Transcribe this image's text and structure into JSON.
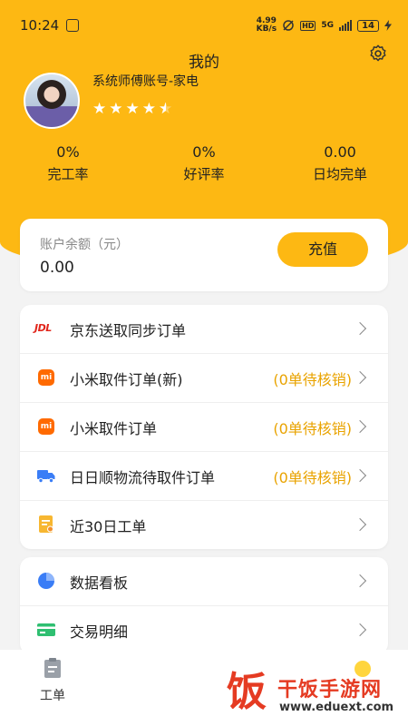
{
  "status_bar": {
    "time": "10:24",
    "speed": "4.99\nKB/s",
    "network": "5G",
    "hd": "HD",
    "battery": "14"
  },
  "header": {
    "title": "我的",
    "account_name": "系统师傅账号-家电",
    "rating_stars": 4.5
  },
  "stats": [
    {
      "value": "0%",
      "label": "完工率"
    },
    {
      "value": "0%",
      "label": "好评率"
    },
    {
      "value": "0.00",
      "label": "日均完单"
    }
  ],
  "balance": {
    "label": "账户余额（元）",
    "value": "0.00",
    "recharge_label": "充值"
  },
  "menu1": [
    {
      "label": "京东送取同步订单",
      "badge": "",
      "icon": "jdl-icon",
      "icon_text": "JDL"
    },
    {
      "label": "小米取件订单(新)",
      "badge": "(0单待核销)",
      "icon": "xiaomi-icon",
      "icon_text": "mi"
    },
    {
      "label": "小米取件订单",
      "badge": "(0单待核销)",
      "icon": "xiaomi-icon",
      "icon_text": "mi"
    },
    {
      "label": "日日顺物流待取件订单",
      "badge": "(0单待核销)",
      "icon": "truck-icon"
    },
    {
      "label": "近30日工单",
      "badge": "",
      "icon": "document-icon"
    }
  ],
  "menu2": [
    {
      "label": "数据看板",
      "icon": "pie-chart-icon"
    },
    {
      "label": "交易明细",
      "icon": "card-icon"
    }
  ],
  "tabbar": {
    "work_label": "工单"
  },
  "watermark": {
    "char": "饭",
    "name": "干饭手游网",
    "url": "www.eduext.com"
  },
  "colors": {
    "accent": "#fdb813",
    "badge": "#e9a300"
  }
}
